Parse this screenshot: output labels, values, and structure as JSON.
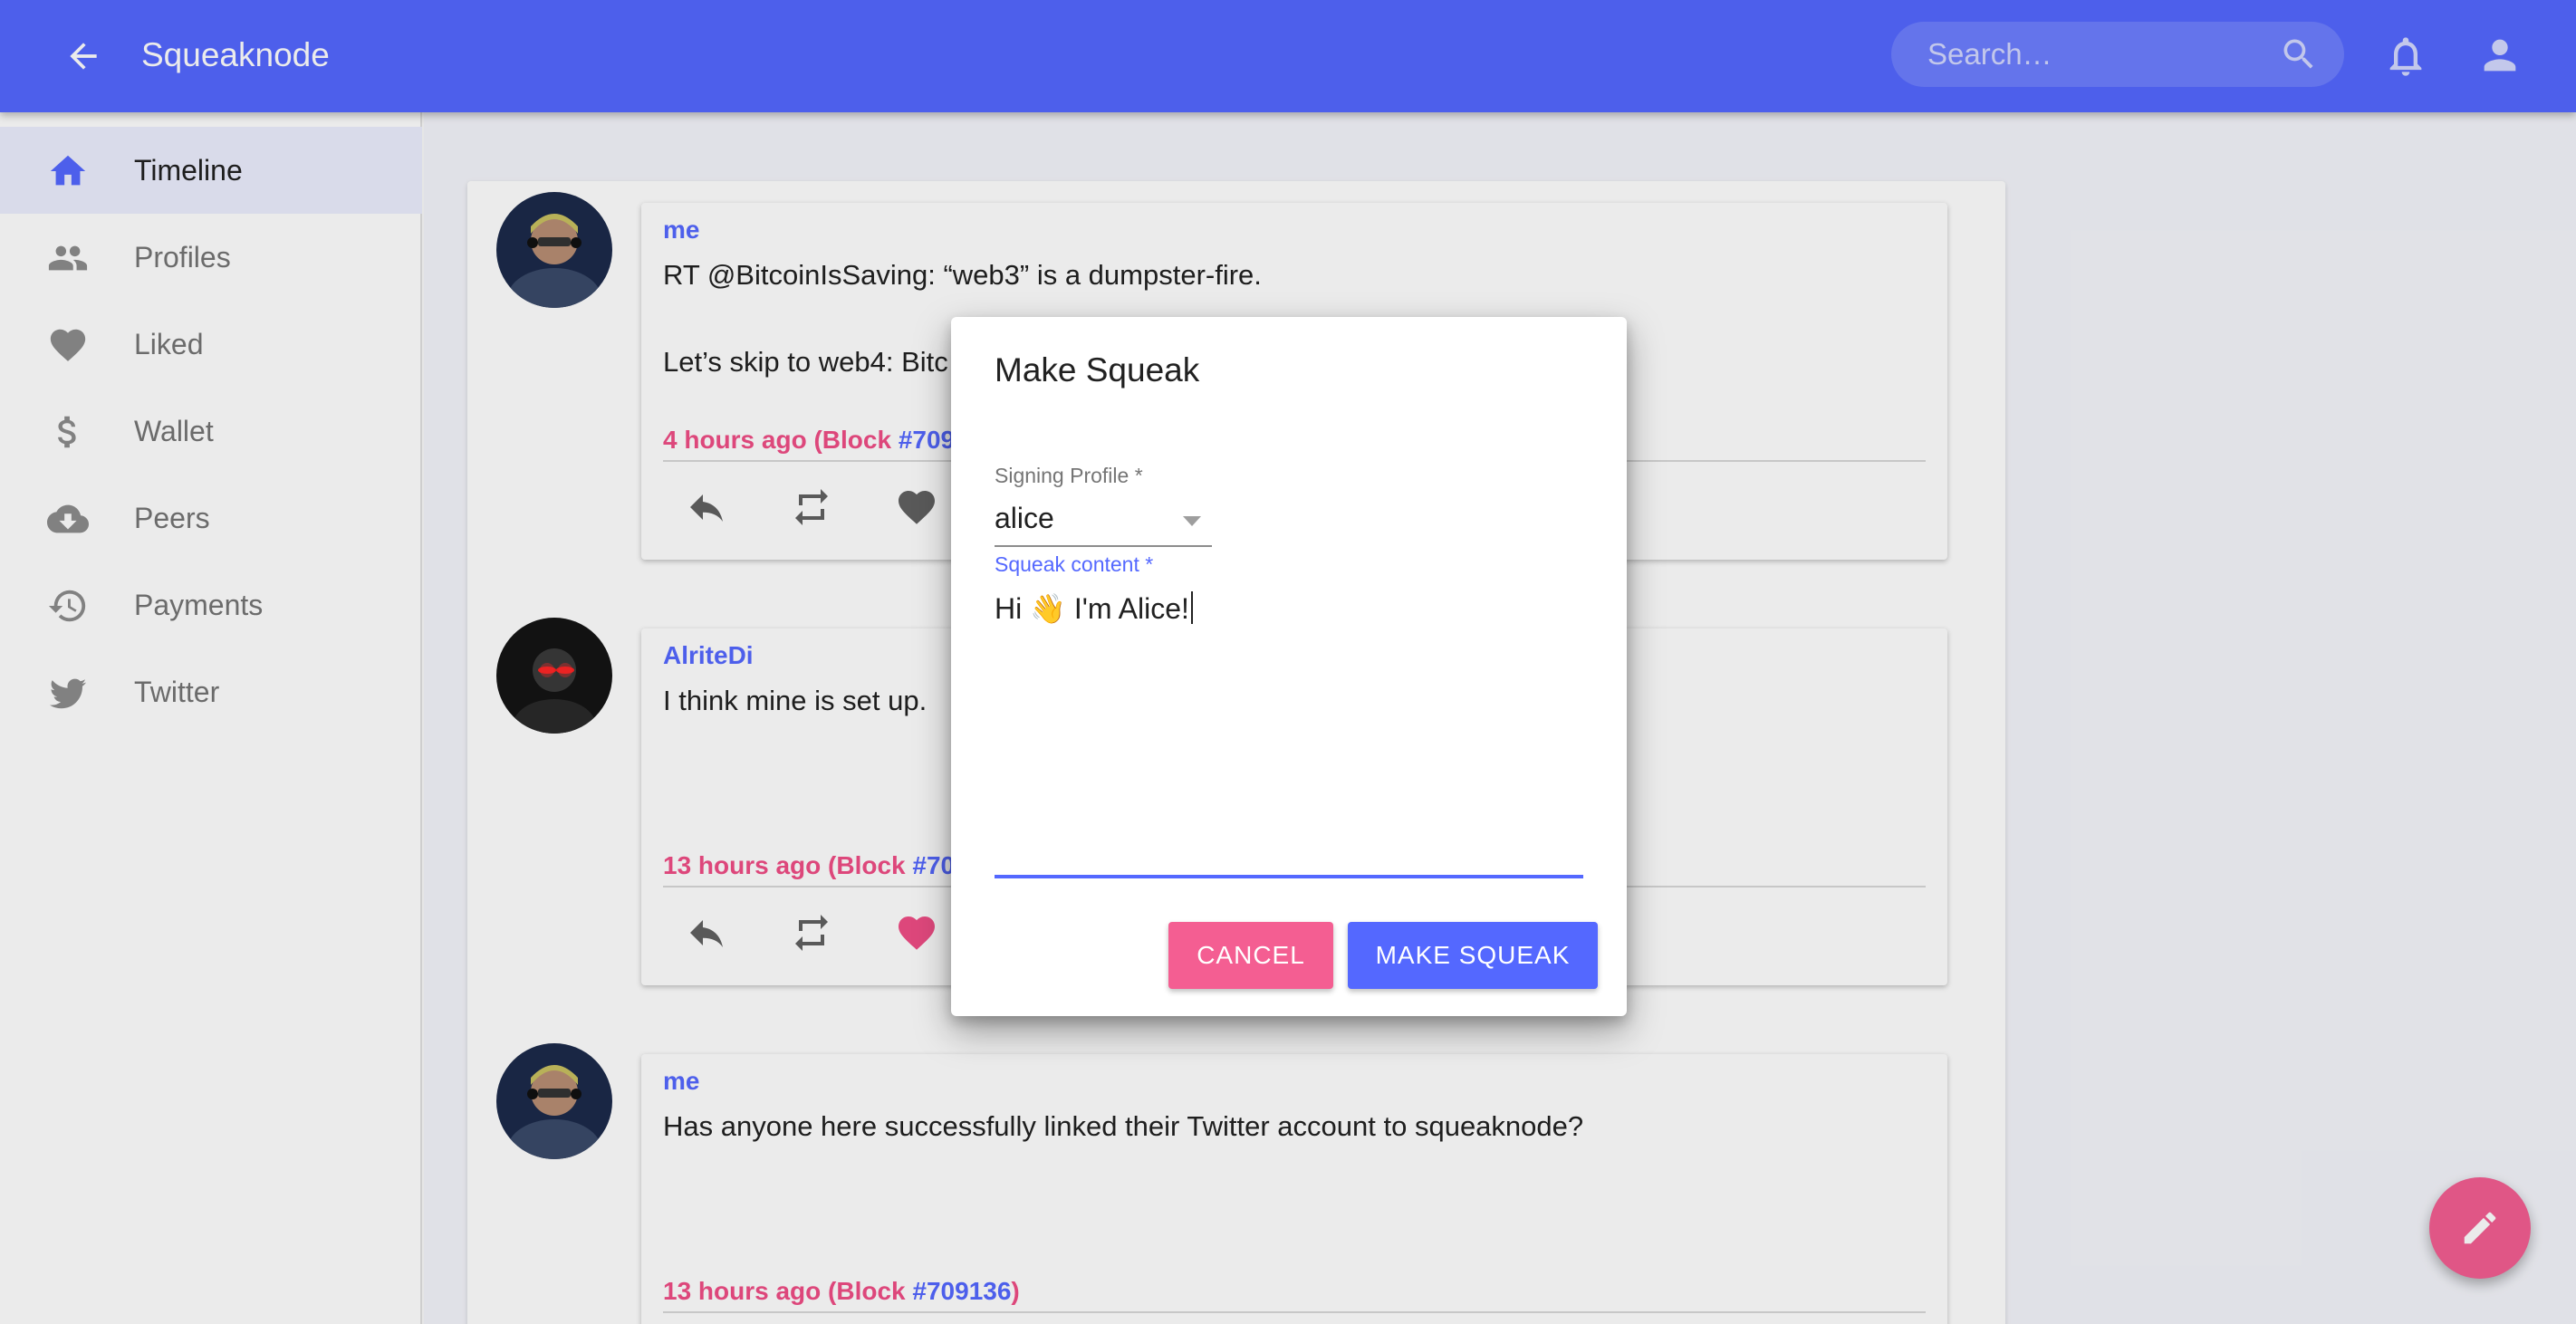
{
  "appbar": {
    "title": "Squeaknode",
    "search_placeholder": "Search…"
  },
  "sidebar": {
    "items": [
      {
        "label": "Timeline",
        "icon": "home-icon"
      },
      {
        "label": "Profiles",
        "icon": "people-icon"
      },
      {
        "label": "Liked",
        "icon": "heart-icon"
      },
      {
        "label": "Wallet",
        "icon": "dollar-icon"
      },
      {
        "label": "Peers",
        "icon": "cloud-download-icon"
      },
      {
        "label": "Payments",
        "icon": "history-icon"
      },
      {
        "label": "Twitter",
        "icon": "twitter-icon"
      }
    ]
  },
  "posts": [
    {
      "author": "me",
      "text": "RT @BitcoinIsSaving: “web3” is a dumpster-fire.\n\nLet’s skip to web4: Bitc",
      "time": "4 hours ago (Block ",
      "block": "#709",
      "liked": false
    },
    {
      "author": "AlriteDi",
      "text": "I think mine is set up.",
      "time": "13 hours ago (Block ",
      "block": "#70",
      "liked": true
    },
    {
      "author": "me",
      "text": "Has anyone here successfully linked their Twitter account to squeaknode?",
      "time": "13 hours ago (Block ",
      "block": "#709136",
      "time_close": ")"
    }
  ],
  "dialog": {
    "title": "Make Squeak",
    "signing_label": "Signing Profile *",
    "signing_value": "alice",
    "content_label": "Squeak content *",
    "content_value": "Hi 👋 I'm Alice!",
    "cancel_label": "CANCEL",
    "submit_label": "MAKE SQUEAK"
  },
  "colors": {
    "primary": "#5468ff",
    "secondary": "#f45e92"
  }
}
